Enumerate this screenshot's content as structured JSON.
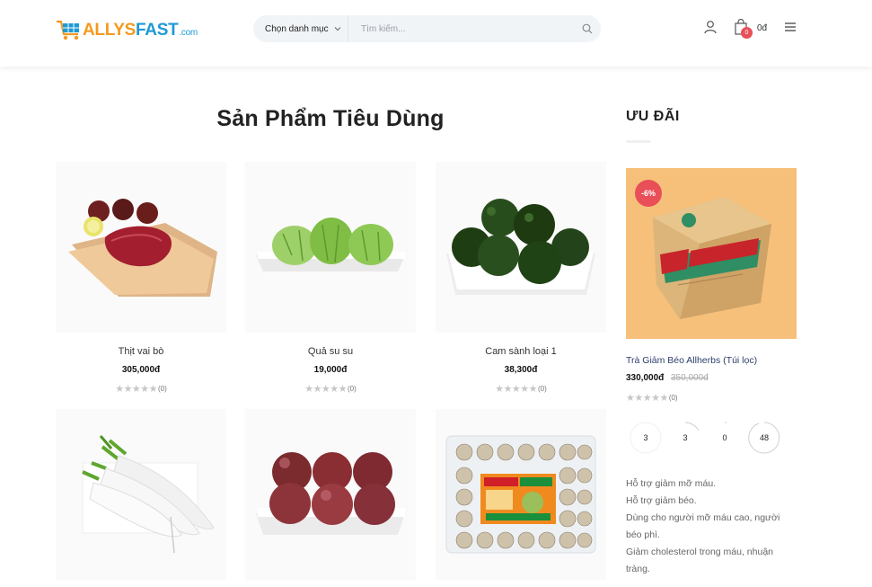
{
  "header": {
    "logo": {
      "text_a": "ALLYS",
      "text_b": "FAST",
      "text_c": ".com"
    },
    "search": {
      "category_label": "Chọn danh mục",
      "placeholder": "Tìm kiếm..."
    },
    "cart": {
      "count": "0",
      "total": "0đ"
    }
  },
  "main": {
    "title": "Sản Phẩm Tiêu Dùng",
    "products": [
      {
        "name": "Thịt vai bò",
        "price": "305,000đ",
        "stars": "★★★★★",
        "rating_count": "(0)"
      },
      {
        "name": "Quả su su",
        "price": "19,000đ",
        "stars": "★★★★★",
        "rating_count": "(0)"
      },
      {
        "name": "Cam sành loại 1",
        "price": "38,300đ",
        "stars": "★★★★★",
        "rating_count": "(0)"
      },
      {
        "name": "",
        "price": "",
        "stars": "",
        "rating_count": ""
      },
      {
        "name": "",
        "price": "",
        "stars": "",
        "rating_count": ""
      },
      {
        "name": "",
        "price": "",
        "stars": "",
        "rating_count": ""
      }
    ]
  },
  "sidebar": {
    "title": "ƯU ĐÃI",
    "promo": {
      "discount": "-6%",
      "name": "Trà Giảm Béo Allherbs (Túi lọc)",
      "price": "330,000đ",
      "old_price": "350,000đ",
      "stars": "★★★★★",
      "rating_count": "(0)",
      "countdown": [
        "3",
        "3",
        "0",
        "48"
      ],
      "description": [
        "Hỗ trợ giảm mỡ máu.",
        "Hỗ trợ giảm béo.",
        "Dùng cho người mỡ máu cao, người béo phì.",
        "Giảm cholesterol trong máu, nhuận tràng."
      ]
    }
  },
  "colors": {
    "accent_red": "#e94f58",
    "logo_orange": "#f39a1e",
    "logo_blue": "#1e9ad6",
    "promo_bg": "#f6c07a"
  }
}
